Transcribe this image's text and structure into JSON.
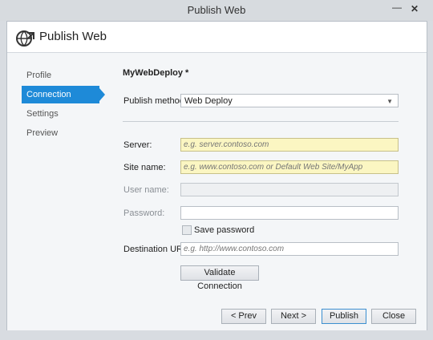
{
  "window": {
    "title": "Publish Web",
    "minimize_glyph": "—",
    "close_glyph": "✕"
  },
  "header": {
    "title": "Publish Web",
    "icon": "publish-globe-icon"
  },
  "nav": {
    "items": [
      {
        "label": "Profile"
      },
      {
        "label": "Connection"
      },
      {
        "label": "Settings"
      },
      {
        "label": "Preview"
      }
    ],
    "active": "Connection"
  },
  "profile_name": "MyWebDeploy *",
  "publish_method": {
    "label": "Publish method:",
    "value": "Web Deploy"
  },
  "fields": {
    "server": {
      "label": "Server:",
      "placeholder": "e.g. server.contoso.com"
    },
    "site_name": {
      "label": "Site name:",
      "placeholder": "e.g. www.contoso.com or Default Web Site/MyApp"
    },
    "user_name": {
      "label": "User name:",
      "value": ""
    },
    "password": {
      "label": "Password:",
      "value": ""
    },
    "save_password": {
      "label": "Save password",
      "checked": false
    },
    "destination_url": {
      "label": "Destination URL:",
      "placeholder": "e.g. http://www.contoso.com"
    }
  },
  "buttons": {
    "validate": "Validate Connection",
    "prev": "< Prev",
    "next": "Next >",
    "publish": "Publish",
    "close": "Close"
  },
  "colors": {
    "accent": "#1e8ad8",
    "required_field": "#fbf6c2"
  }
}
